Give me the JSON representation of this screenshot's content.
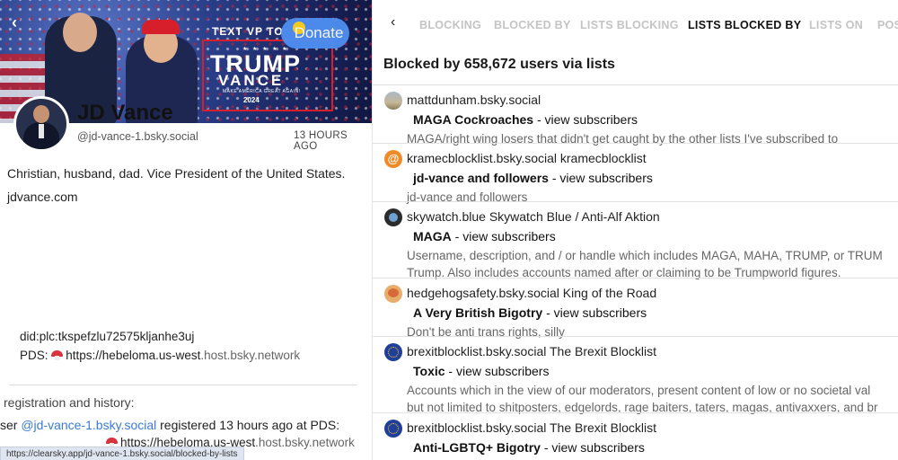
{
  "left": {
    "banner": {
      "headline": "TEXT VP TO",
      "stars": "★ ★ ★ ★ ★",
      "trump": "TRUMP",
      "vance": "VANCE",
      "slogan": "MAKE AMERICA GREAT AGAIN!",
      "year": "2024"
    },
    "donate_label": "Donate",
    "back_label": "‹",
    "profile": {
      "name": "JD Vance",
      "handle": "@jd-vance-1.bsky.social",
      "time_ago": "13 HOURS AGO",
      "bio": "Christian, husband, dad. Vice President of the United States.",
      "website": "jdvance.com"
    },
    "did": "did:plc:tkspefzlu72575kljanhe3uj",
    "pds": {
      "label": "PDS:",
      "url_main": "https://hebeloma.us-west",
      "url_rest": ".host.bsky.network"
    },
    "registration": {
      "title": "registration and history:",
      "prefix": "ser",
      "handle_link": "@jd-vance-1.bsky.social",
      "text": "registered 13 hours ago  at PDS:",
      "pds_main": "https://hebeloma.us-west",
      "pds_rest": ".host.bsky.network"
    },
    "status_url": "https://clearsky.app/jd-vance-1.bsky.social/blocked-by-lists"
  },
  "right": {
    "back_label": "‹",
    "tabs": [
      {
        "label": "BLOCKING",
        "active": false
      },
      {
        "label": "BLOCKED BY",
        "active": false
      },
      {
        "label": "LISTS BLOCKING",
        "active": false
      },
      {
        "label": "LISTS BLOCKED BY",
        "active": true
      },
      {
        "label": "LISTS ON",
        "active": false
      },
      {
        "label": "POS",
        "active": false
      }
    ],
    "heading": "Blocked by 658,672 users via lists",
    "view_subscribers": "view subscribers",
    "items": [
      {
        "icon": "profile-photo-icon",
        "who": "mattdunham.bsky.social",
        "list_name": "MAGA Cockroaches",
        "desc_lines": [
          "MAGA/right wing losers that didn't get caught by the other lists I've subscribed to"
        ]
      },
      {
        "icon": "at-sign-icon",
        "who": "kramecblocklist.bsky.social kramecblocklist",
        "list_name": "jd-vance and followers",
        "desc_lines": [
          "jd-vance and followers"
        ]
      },
      {
        "icon": "skywatch-icon",
        "who": "skywatch.blue Skywatch Blue / Anti-Alf Aktion",
        "list_name": "MAGA",
        "desc_lines": [
          "Username, description, and / or handle which includes MAGA, MAHA, TRUMP, or TRUM",
          "Trump. Also includes accounts named after or claiming to be Trumpworld figures."
        ]
      },
      {
        "icon": "hedgehog-icon",
        "who": "hedgehogsafety.bsky.social King of the Road",
        "list_name": "A Very British Bigotry",
        "desc_lines": [
          "Don't be anti trans rights, silly"
        ]
      },
      {
        "icon": "eu-flag-icon",
        "who": "brexitblocklist.bsky.social The Brexit Blocklist",
        "list_name": "Toxic",
        "desc_lines": [
          "Accounts which in the view of our moderators, present content of low or no societal val",
          "but not limited to shitposters, edgelords, rage baiters, taters, magas, antivaxxers, and br"
        ]
      },
      {
        "icon": "eu-flag-icon",
        "who": "brexitblocklist.bsky.social The Brexit Blocklist",
        "list_name": "Anti-LGBTQ+ Bigotry",
        "desc_lines": []
      }
    ]
  }
}
